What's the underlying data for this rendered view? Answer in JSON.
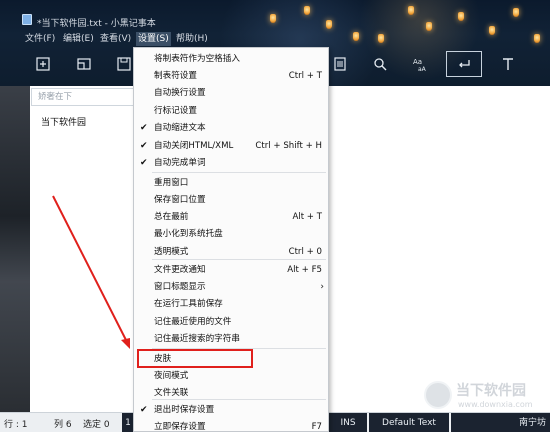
{
  "window": {
    "title": "*当下软件园.txt - 小黑记事本"
  },
  "menu_bar": [
    {
      "label": "文件(F)"
    },
    {
      "label": "编辑(E)"
    },
    {
      "label": "查看(V)"
    },
    {
      "label": "设置(S)",
      "active": true
    },
    {
      "label": "帮助(H)"
    }
  ],
  "toolbar": {
    "icons": [
      "new-file-icon",
      "open-icon",
      "save-icon",
      "list-icon",
      "search-icon",
      "font-size-icon",
      "enter-icon",
      "text-icon"
    ]
  },
  "search": {
    "placeholder": "娇奢在下"
  },
  "editor": {
    "content": "当下软件园"
  },
  "settings_menu": {
    "items": [
      {
        "label": "将制表符作为空格插入",
        "shortcut": "",
        "checked": false
      },
      {
        "label": "制表符设置",
        "shortcut": "Ctrl + T",
        "checked": false
      },
      {
        "label": "自动换行设置",
        "shortcut": "",
        "checked": false
      },
      {
        "label": "行标记设置",
        "shortcut": "",
        "checked": false
      },
      {
        "label": "自动缩进文本",
        "shortcut": "",
        "checked": true
      },
      {
        "label": "自动关闭HTML/XML",
        "shortcut": "Ctrl + Shift + H",
        "checked": true
      },
      {
        "label": "自动完成单词",
        "shortcut": "",
        "checked": true
      },
      {
        "label": "重用窗口",
        "shortcut": "",
        "checked": false
      },
      {
        "label": "保存窗口位置",
        "shortcut": "",
        "checked": false
      },
      {
        "label": "总在最前",
        "shortcut": "Alt + T",
        "checked": false
      },
      {
        "label": "最小化到系统托盘",
        "shortcut": "",
        "checked": false
      },
      {
        "label": "透明模式",
        "shortcut": "Ctrl + 0",
        "checked": false
      },
      {
        "label": "文件更改通知",
        "shortcut": "Alt + F5",
        "checked": false
      },
      {
        "label": "窗口标题显示",
        "shortcut": "",
        "checked": false,
        "submenu": true
      },
      {
        "label": "在运行工具前保存",
        "shortcut": "",
        "checked": false
      },
      {
        "label": "记住最近使用的文件",
        "shortcut": "",
        "checked": false
      },
      {
        "label": "记住最近搜索的字符串",
        "shortcut": "",
        "checked": false
      },
      {
        "label": "皮肤",
        "shortcut": "",
        "checked": false
      },
      {
        "label": "夜间模式",
        "shortcut": "",
        "checked": false
      },
      {
        "label": "文件关联",
        "shortcut": "",
        "checked": false
      },
      {
        "label": "退出时保存设置",
        "shortcut": "",
        "checked": true
      },
      {
        "label": "立即保存设置",
        "shortcut": "F7",
        "checked": false
      }
    ]
  },
  "status_bar": {
    "line": "行 : 1",
    "col": "列 6",
    "selected": "选定 0",
    "first_box": "1",
    "ins": "INS",
    "scheme": "Default Text",
    "tail": "南宁坊"
  },
  "watermark": {
    "text": "当下软件园",
    "url": "www.downxia.com"
  },
  "colors": {
    "highlight": "#e0201c",
    "arrow": "#e0201c",
    "menu_active": "#3b4f66"
  }
}
